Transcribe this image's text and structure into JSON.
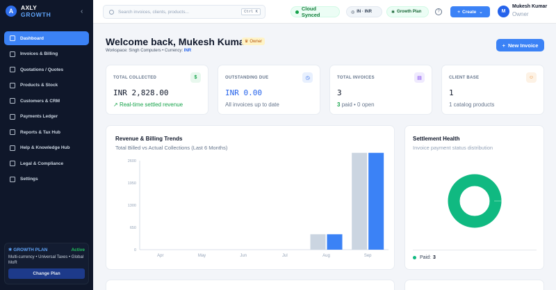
{
  "brand": {
    "logo_letter": "A",
    "name": "AXLY",
    "sub": "GROWTH"
  },
  "sidebar": {
    "items": [
      {
        "label": "Dashboard",
        "icon": "grid-icon",
        "active": true
      },
      {
        "label": "Invoices & Billing",
        "icon": "file-icon"
      },
      {
        "label": "Quotations / Quotes",
        "icon": "clipboard-icon"
      },
      {
        "label": "Products & Stock",
        "icon": "box-icon"
      },
      {
        "label": "Customers & CRM",
        "icon": "users-icon"
      },
      {
        "label": "Payments Ledger",
        "icon": "card-icon"
      },
      {
        "label": "Reports & Tax Hub",
        "icon": "trend-icon"
      },
      {
        "label": "Help & Knowledge Hub",
        "icon": "tools-icon"
      },
      {
        "label": "Legal & Compliance",
        "icon": "shield-icon"
      },
      {
        "label": "Settings",
        "icon": "gear-icon"
      }
    ],
    "plan": {
      "title": "GROWTH PLAN",
      "status": "Active",
      "description": "Multi-currency • Universal Taxes • Global MoR",
      "button": "Change Plan"
    }
  },
  "header": {
    "search_placeholder": "Search invoices, clients, products...",
    "shortcut": "Ctrl K",
    "sync_label": "Cloud Synced",
    "locale_label": "IN · INR",
    "plan_label": "Growth Plan",
    "help": "?",
    "create_label": "Create",
    "user": {
      "initial": "M",
      "name": "Mukesh Kumar",
      "role": "Owner"
    }
  },
  "welcome": {
    "title": "Welcome back, Mukesh Kumar",
    "badge": "Owner",
    "workspace_prefix": "Workspace: Singh Computers • Currency:",
    "currency": "INR",
    "new_invoice": "New Invoice"
  },
  "stats": [
    {
      "label": "TOTAL COLLECTED",
      "icon": "$",
      "value": "INR 2,828.00",
      "sub": "Real-time settled revenue",
      "icon_bg": "#e8f8ee",
      "icon_color": "#16a34a"
    },
    {
      "label": "OUTSTANDING DUE",
      "icon": "◷",
      "value": "INR 0.00",
      "sub": "All invoices up to date",
      "icon_bg": "#e8f0fe",
      "icon_color": "#2563eb"
    },
    {
      "label": "TOTAL INVOICES",
      "icon": "▤",
      "value": "3",
      "sub_num": "3",
      "sub": "paid • 0 open",
      "icon_bg": "#efeafe",
      "icon_color": "#7c3aed"
    },
    {
      "label": "CLIENT BASE",
      "icon": "☺",
      "value": "1",
      "sub": "1 catalog products",
      "icon_bg": "#fdf2e5",
      "icon_color": "#ea8a2c"
    }
  ],
  "revenue_chart": {
    "title": "Revenue & Billing Trends",
    "subtitle": "Total Billed vs Actual Collections (Last 6 Months)"
  },
  "chart_data": {
    "type": "bar",
    "categories": [
      "Apr",
      "May",
      "Jun",
      "Jul",
      "Aug",
      "Sep"
    ],
    "series": [
      {
        "name": "Total Billed",
        "values": [
          0,
          0,
          0,
          0,
          450,
          2828
        ],
        "color": "#cbd5e1"
      },
      {
        "name": "Actual Collections",
        "values": [
          0,
          0,
          0,
          0,
          450,
          2828
        ],
        "color": "#3b82f6"
      }
    ],
    "yticks": [
      "0",
      "650",
      "1300",
      "1950",
      "2600"
    ],
    "ylim": [
      0,
      2600
    ],
    "grid": false
  },
  "settlement": {
    "title": "Settlement Health",
    "subtitle": "Invoice payment status distribution",
    "legend_label": "Paid:",
    "legend_value": "3",
    "paid_color": "#10b981"
  }
}
